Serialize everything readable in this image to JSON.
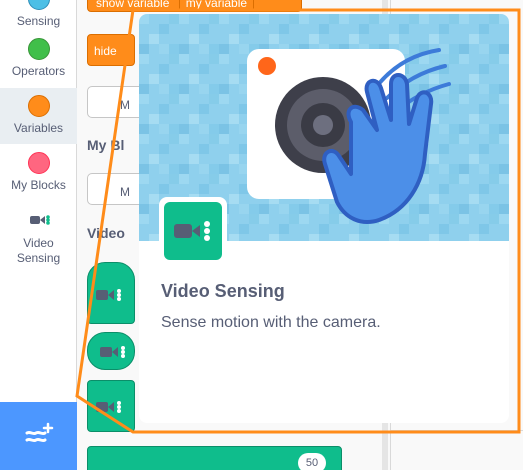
{
  "categories": [
    {
      "label": "Sensing",
      "color": "#4cbfe6",
      "border": "#2e8eb8",
      "icon": "sensing-dot"
    },
    {
      "label": "Operators",
      "color": "#40bf4a",
      "border": "#389438",
      "icon": "operators-dot"
    },
    {
      "label": "Variables",
      "color": "#ff8c1a",
      "border": "#db6e00",
      "icon": "variables-dot",
      "selected": true
    },
    {
      "label": "My Blocks",
      "color": "#ff6680",
      "border": "#ff3355",
      "icon": "my-blocks-dot"
    },
    {
      "label": "Video Sensing",
      "color": "#0fbd8c",
      "icon": "video-camera-icon"
    }
  ],
  "extension_button": {
    "icon": "add-extension-icon"
  },
  "palette": {
    "show_block_label": "show variable",
    "show_block_value": "my variable",
    "hide_block_label": "hide",
    "make_variable_short": "M",
    "my_blocks_heading": "My Bl",
    "make_block_short": "M",
    "video_heading": "Video",
    "bottom_block_value": "50"
  },
  "tooltip": {
    "title": "Video Sensing",
    "description": "Sense motion with the camera.",
    "banner_icon": "video-camera-wave-hand-illustration",
    "tile_icon": "video-camera-icon"
  },
  "colors": {
    "highlight": "#ff8c1a",
    "extension_blue": "#4c97ff",
    "video_green": "#0fbd8c",
    "banner_blue": "#8fd0ed"
  }
}
